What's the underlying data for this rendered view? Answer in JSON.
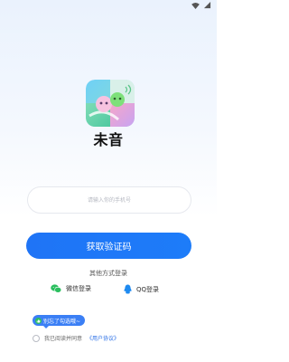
{
  "app": {
    "name": "未音"
  },
  "login": {
    "phone_placeholder": "请输入你的手机号",
    "get_code_label": "获取验证码",
    "other_methods_title": "其他方式登录",
    "wechat_label": "微信登录",
    "qq_label": "QQ登录"
  },
  "agreement": {
    "tip": "别忘了勾选哦~",
    "prefix": "我已阅读并同意",
    "link": "《用户协议》"
  },
  "colors": {
    "accent": "#1f74f6",
    "wechat": "#2bbf5f",
    "qq": "#1e8af0"
  },
  "icons": {
    "status": [
      "wifi-icon",
      "battery-icon"
    ],
    "wechat": "wechat-icon",
    "qq": "qq-icon",
    "tip": "thumbs-up-icon"
  }
}
